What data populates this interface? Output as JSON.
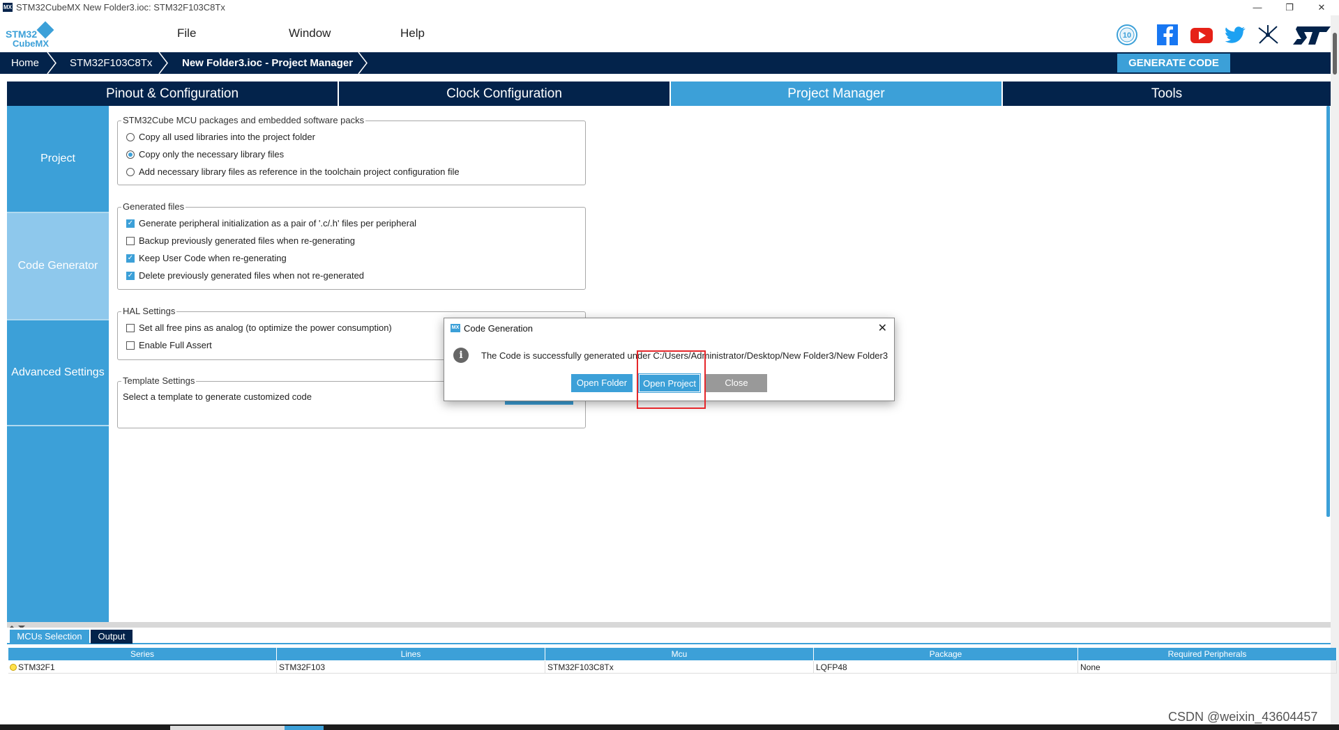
{
  "window": {
    "title": "STM32CubeMX New Folder3.ioc: STM32F103C8Tx",
    "app_icon": "MX",
    "controls": [
      "—",
      "❐",
      "✕"
    ]
  },
  "menubar": {
    "logo_line1": "STM32",
    "logo_line2": "CubeMX",
    "items": [
      "File",
      "Window",
      "Help"
    ],
    "social_icons": [
      "anniversary-badge-icon",
      "facebook-icon",
      "youtube-icon",
      "twitter-icon",
      "network-icon",
      "st-logo-icon"
    ],
    "badge_text": "10"
  },
  "breadcrumb": {
    "items": [
      "Home",
      "STM32F103C8Tx",
      "New Folder3.ioc - Project Manager"
    ],
    "generate_button": "GENERATE CODE"
  },
  "tabs": [
    {
      "label": "Pinout & Configuration",
      "active": false
    },
    {
      "label": "Clock Configuration",
      "active": false
    },
    {
      "label": "Project Manager",
      "active": true
    },
    {
      "label": "Tools",
      "active": false
    }
  ],
  "leftnav": [
    "Project",
    "Code Generator",
    "Advanced Settings"
  ],
  "groups": {
    "packages": {
      "title": "STM32Cube MCU packages and embedded software packs",
      "options": [
        "Copy all used libraries into the project folder",
        "Copy only the necessary library files",
        "Add necessary library files as reference in the toolchain project configuration file"
      ],
      "selected_index": 1
    },
    "generated": {
      "title": "Generated files",
      "options": [
        {
          "label": "Generate peripheral initialization as a pair of '.c/.h' files per peripheral",
          "checked": true
        },
        {
          "label": "Backup previously generated files when re-generating",
          "checked": false
        },
        {
          "label": "Keep User Code when re-generating",
          "checked": true
        },
        {
          "label": "Delete previously generated files when not re-generated",
          "checked": true
        }
      ]
    },
    "hal": {
      "title": "HAL Settings",
      "options": [
        {
          "label": "Set all free pins as analog (to optimize the power consumption)",
          "checked": false
        },
        {
          "label": "Enable Full Assert",
          "checked": false
        }
      ]
    },
    "template": {
      "title": "Template Settings",
      "text": "Select a template to generate customized code"
    }
  },
  "bottom": {
    "tabs": [
      "MCUs Selection",
      "Output"
    ],
    "columns": [
      "Series",
      "Lines",
      "Mcu",
      "Package",
      "Required Peripherals"
    ],
    "rows": [
      [
        "STM32F1",
        "STM32F103",
        "STM32F103C8Tx",
        "LQFP48",
        "None"
      ]
    ]
  },
  "dialog": {
    "title": "Code Generation",
    "message": "The Code is successfully generated under C:/Users/Administrator/Desktop/New Folder3/New Folder3",
    "buttons": [
      "Open Folder",
      "Open Project",
      "Close"
    ],
    "close_glyph": "✕"
  },
  "watermark": "CSDN @weixin_43604457",
  "colors": {
    "navy": "#03234b",
    "accent": "#3ca0d8",
    "highlight": "#e5262a"
  }
}
